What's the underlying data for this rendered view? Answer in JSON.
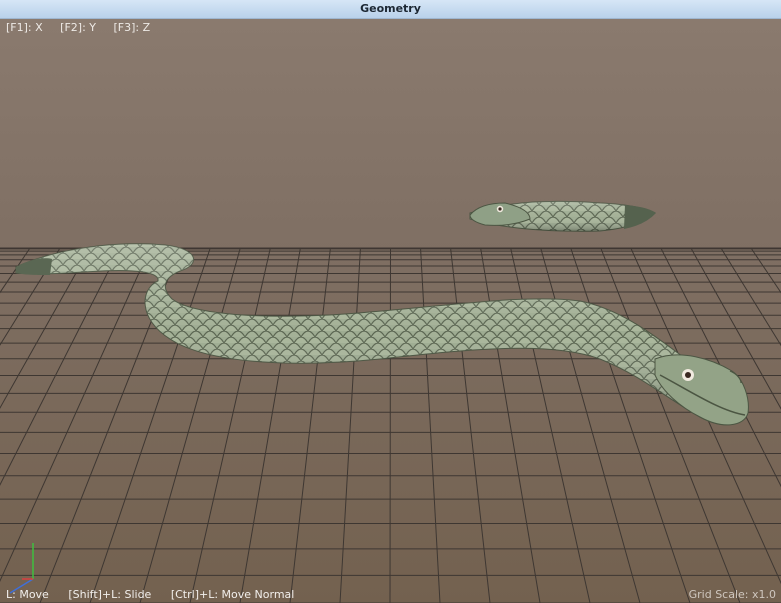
{
  "window": {
    "title": "Geometry"
  },
  "axis_hints": [
    {
      "label": "[F1]: X"
    },
    {
      "label": "[F2]: Y"
    },
    {
      "label": "[F3]: Z"
    }
  ],
  "status": {
    "actions": [
      "L: Move",
      "[Shift]+L: Slide",
      "[Ctrl]+L: Move Normal"
    ],
    "grid_scale": "Grid Scale: x1.0"
  },
  "colors": {
    "title_bar": "#c9dcf0",
    "viewport_bg": "#7f6f63",
    "grid_line": "#3f3833",
    "snake_body": "#9aa88e",
    "snake_scale_edge": "#56604c"
  }
}
